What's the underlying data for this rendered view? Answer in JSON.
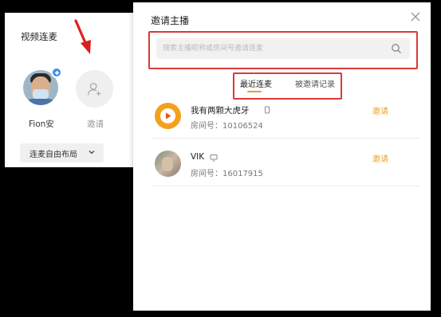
{
  "left_panel": {
    "title": "视频连麦",
    "user_name": "Fion安",
    "invite_label": "邀请",
    "layout_button": "连麦自由布局"
  },
  "dialog": {
    "title": "邀请主播",
    "search": {
      "placeholder": "搜索主播昵称或房间号邀请连麦"
    },
    "tabs": [
      {
        "label": "最近连麦",
        "active": true
      },
      {
        "label": "被邀请记录",
        "active": false
      }
    ],
    "hosts": [
      {
        "name": "我有两颗大虎牙",
        "room": "房间号：10106524",
        "device_icon": "phone-icon",
        "invite": "邀请"
      },
      {
        "name": "VIK",
        "room": "房间号：16017915",
        "device_icon": "monitor-icon",
        "invite": "邀请"
      }
    ]
  },
  "colors": {
    "accent": "#f0a020",
    "highlight": "#d93a3a"
  }
}
